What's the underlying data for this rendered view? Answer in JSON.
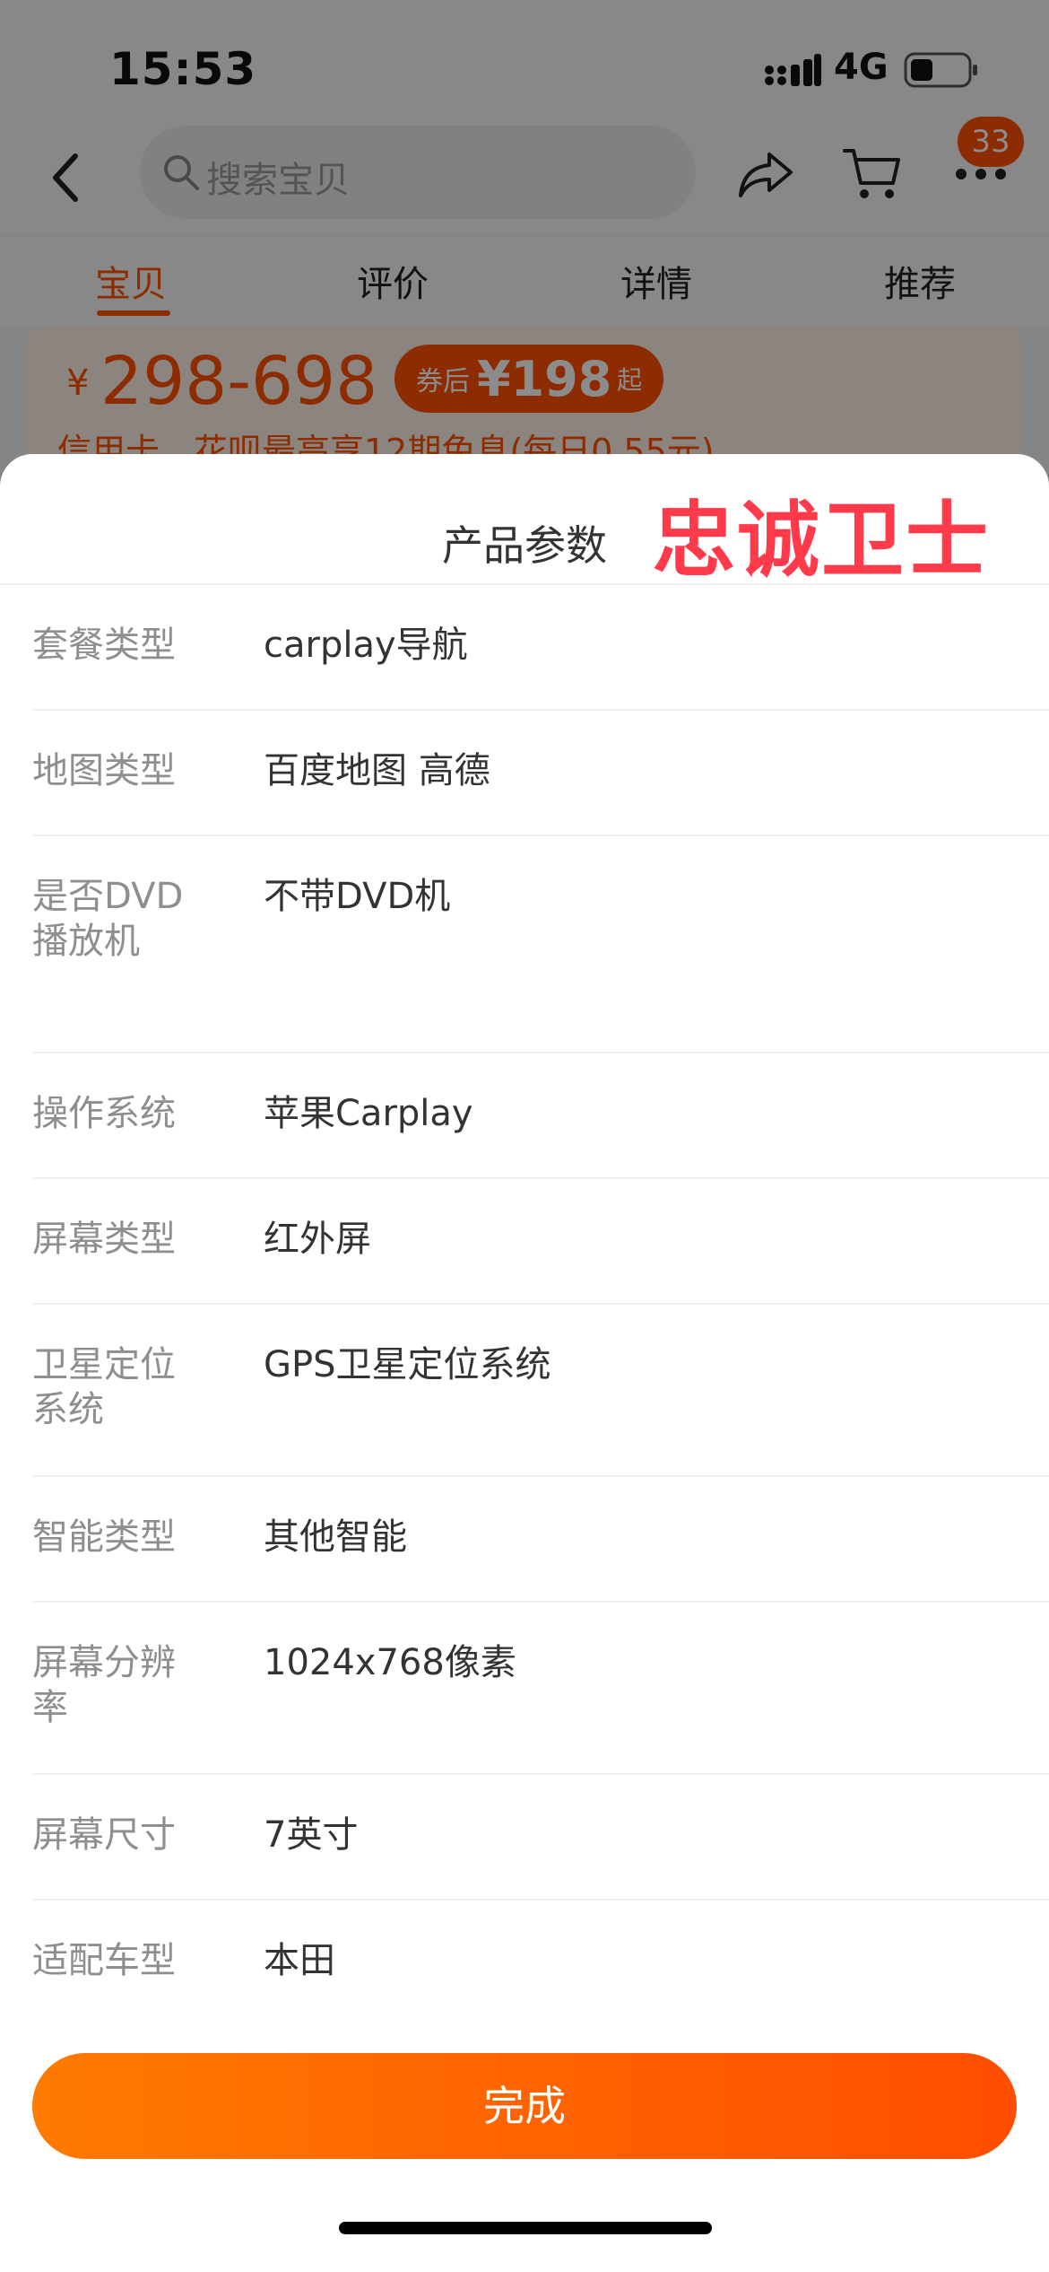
{
  "status_bar": {
    "time": "15:53",
    "network": "4G",
    "icons": [
      "signal-icon",
      "battery-icon"
    ]
  },
  "nav": {
    "search_placeholder": "搜索宝贝",
    "cart_badge": "33",
    "icons": [
      "back-icon",
      "search-icon",
      "share-icon",
      "cart-icon",
      "more-icon"
    ]
  },
  "tabs": [
    {
      "label": "宝贝",
      "active": true
    },
    {
      "label": "评价",
      "active": false
    },
    {
      "label": "详情",
      "active": false
    },
    {
      "label": "推荐",
      "active": false
    }
  ],
  "price": {
    "symbol": "¥",
    "range": "298-698",
    "coupon_prefix": "券后",
    "coupon_amount": "¥198",
    "coupon_suffix": "起",
    "installment": "信用卡、花呗最高享12期免息(每日0.55元)"
  },
  "sheet": {
    "title": "产品参数",
    "watermark": "忠诚卫士",
    "done_label": "完成",
    "params": [
      {
        "label": "套餐类型",
        "value": "carplay导航"
      },
      {
        "label": "地图类型",
        "value": "百度地图 高德"
      },
      {
        "label": "是否DVD播放机",
        "value": "不带DVD机"
      },
      {
        "label": "操作系统",
        "value": "苹果Carplay"
      },
      {
        "label": "屏幕类型",
        "value": "红外屏"
      },
      {
        "label": "卫星定位系统",
        "value": "GPS卫星定位系统"
      },
      {
        "label": "智能类型",
        "value": "其他智能"
      },
      {
        "label": "屏幕分辨率",
        "value": "1024x768像素"
      },
      {
        "label": "屏幕尺寸",
        "value": "7英寸"
      },
      {
        "label": "适配车型",
        "value": "本田"
      }
    ]
  },
  "colors": {
    "accent": "#ff5000",
    "watermark": "#ff3a4a",
    "button_start": "#ff7a00",
    "button_end": "#ff4d00"
  }
}
